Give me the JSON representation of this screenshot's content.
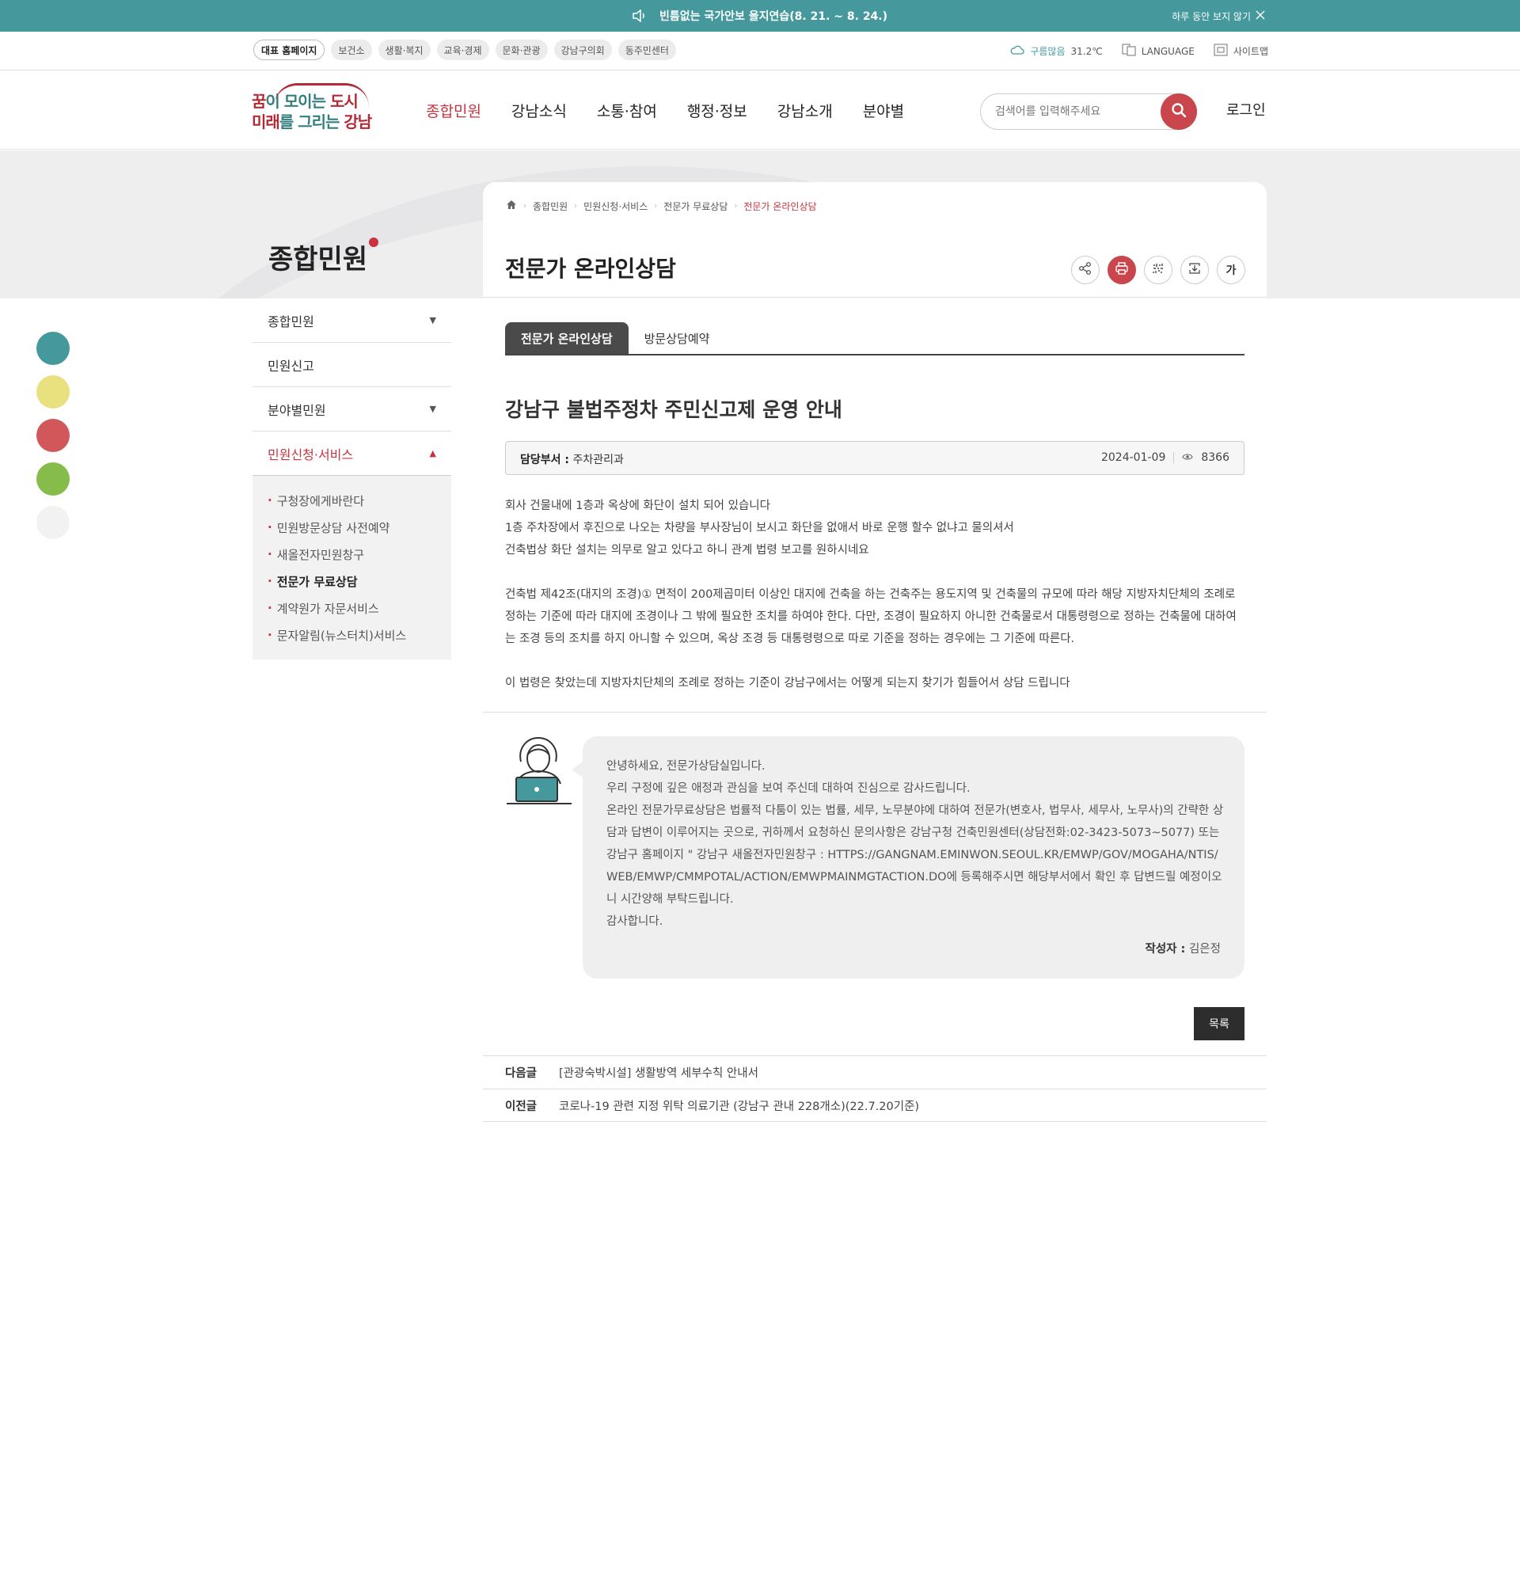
{
  "notice": {
    "text": "빈틈없는 국가안보 을지연습(8. 21. ~ 8. 24.)",
    "close_today": "하루 동안 보지 않기",
    "speaker_icon": "speaker-icon",
    "close_icon": "close-icon"
  },
  "util": {
    "links": [
      "대표 홈페이지",
      "보건소",
      "생활·복지",
      "교육·경제",
      "문화·관광",
      "강남구의회",
      "동주민센터"
    ],
    "weather_label": "구름많음",
    "weather_temp": "31.2℃",
    "language": "LANGUAGE",
    "sitemap": "사이트맵"
  },
  "header": {
    "logo_line1_a": "꿈",
    "logo_line1_b": "이 모이는 ",
    "logo_line1_c": "도시",
    "logo_line2_a": "미래",
    "logo_line2_b": "를 그리는 ",
    "logo_line2_c": "강남",
    "gnb": [
      "종합민원",
      "강남소식",
      "소통·참여",
      "행정·정보",
      "강남소개",
      "분야별"
    ],
    "search_placeholder": "검색어를 입력해주세요",
    "login": "로그인"
  },
  "sidebar": {
    "title": "종합민원",
    "items": [
      {
        "label": "종합민원",
        "arrow": "▼"
      },
      {
        "label": "민원신고",
        "arrow": ""
      },
      {
        "label": "분야별민원",
        "arrow": "▼"
      },
      {
        "label": "민원신청·서비스",
        "arrow": "▲"
      }
    ],
    "sub_items": [
      "구청장에게바란다",
      "민원방문상담 사전예약",
      "새올전자민원창구",
      "전문가 무료상담",
      "계약원가 자문서비스",
      "문자알림(뉴스터치)서비스"
    ],
    "quick_colors": [
      "#45999c",
      "#e9e07f",
      "#d1575b",
      "#86bc4a",
      "#f2f2f2"
    ]
  },
  "content": {
    "breadcrumb": [
      "종합민원",
      "민원신청·서비스",
      "전문가 무료상담",
      "전문가 온라인상담"
    ],
    "page_title": "전문가 온라인상담",
    "tools": {
      "font_label": "가"
    },
    "tabs": [
      "전문가 온라인상담",
      "방문상담예약"
    ],
    "post_title": "강남구 불법주정차 주민신고제 운영 안내",
    "dept_label": "담당부서 :",
    "dept_value": "주차관리과",
    "date": "2024-01-09",
    "views": "8366",
    "body": [
      "회사 건물내에 1층과 옥상에 화단이 설치 되어 있습니다",
      "1층 주차장에서 후진으로 나오는 차량을 부사장님이 보시고 화단을 없애서 바로 운행 할수 없냐고 물의셔서",
      "건축법상 화단 설치는 의무로 알고 있다고 하니 관계 법령 보고를 원하시네요",
      "",
      "건축법 제42조(대지의 조경)① 면적이 200제곱미터 이상인 대지에 건축을 하는 건축주는 용도지역 및 건축물의 규모에 따라 해당 지방자치단체의 조례로 정하는 기준에 따라 대지에 조경이나 그 밖에 필요한 조치를 하여야 한다. 다만, 조경이 필요하지 아니한 건축물로서 대통령령으로 정하는 건축물에 대하여는 조경 등의 조치를 하지 아니할 수 있으며, 옥상 조경 등 대통령령으로 따로 기준을 정하는 경우에는 그 기준에 따른다.",
      "",
      "이 법령은 찾았는데 지방자치단체의 조례로 정하는 기준이 강남구에서는 어떻게 되는지 찾기가 힘들어서 상담 드립니다"
    ],
    "answer": [
      "안녕하세요, 전문가상담실입니다.",
      "우리 구정에 깊은 애정과 관심을 보여 주신데 대하여 진심으로 감사드립니다.",
      "온라인 전문가무료상담은 법률적 다툼이 있는 법률, 세무, 노무분야에 대하여 전문가(변호사, 법무사, 세무사, 노무사)의 간략한 상담과 답변이 이루어지는 곳으로, 귀하께서 요청하신 문의사항은 강남구청 건축민원센터(상담전화:02-3423-5073~5077) 또는 강남구 홈페이지 \" 강남구 새올전자민원창구 : HTTPS://GANGNAM.EMINWON.SEOUL.KR/EMWP/GOV/MOGAHA/NTIS/WEB/EMWP/CMMPOTAL/ACTION/EMWPMAINMGTACTION.DO에 등록해주시면 해당부서에서 확인 후 답변드릴 예정이오니 시간양해 부탁드립니다.",
      "감사합니다."
    ],
    "writer_label": "작성자 :",
    "writer": "김은정",
    "list_button": "목록",
    "next_label": "다음글",
    "next_title": "[관광숙박시설] 생활방역 세부수칙 안내서",
    "prev_label": "이전글",
    "prev_title": "코로나-19 관련 지정 위탁 의료기관 (강남구 관내 228개소)(22.7.20기준)"
  }
}
